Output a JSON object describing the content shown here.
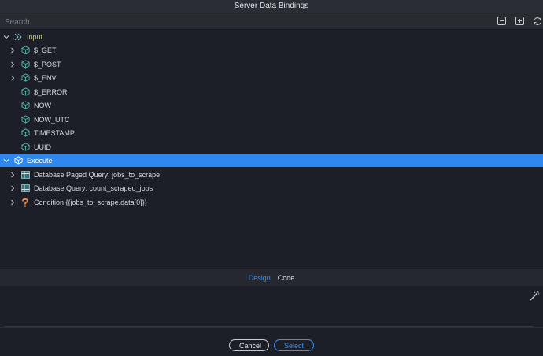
{
  "window": {
    "title": "Server Data Bindings"
  },
  "search": {
    "placeholder": "Search"
  },
  "toolbar": {
    "collapse_icon": "minus-square-icon",
    "expand_icon": "plus-square-icon",
    "refresh_icon": "refresh-icon"
  },
  "tree": {
    "input": {
      "label": "Input",
      "children": [
        {
          "label": "$_GET",
          "expandable": true
        },
        {
          "label": "$_POST",
          "expandable": true
        },
        {
          "label": "$_ENV",
          "expandable": true
        },
        {
          "label": "$_ERROR",
          "expandable": false
        },
        {
          "label": "NOW",
          "expandable": false
        },
        {
          "label": "NOW_UTC",
          "expandable": false
        },
        {
          "label": "TIMESTAMP",
          "expandable": false
        },
        {
          "label": "UUID",
          "expandable": false
        }
      ]
    },
    "execute": {
      "label": "Execute",
      "children": [
        {
          "label": "Database Paged Query: jobs_to_scrape",
          "icon": "table-icon"
        },
        {
          "label": "Database Query: count_scraped_jobs",
          "icon": "table-icon"
        },
        {
          "label": "Condition {{jobs_to_scrape.data[0]}}",
          "icon": "question-icon"
        }
      ]
    }
  },
  "tabs": {
    "design": "Design",
    "code": "Code"
  },
  "footer": {
    "cancel_label": "Cancel",
    "select_label": "Select"
  },
  "colors": {
    "accent": "#2f88ef",
    "cube": "#4fb3a6",
    "table": "#5a9ea0",
    "question": "#e08a3a"
  }
}
